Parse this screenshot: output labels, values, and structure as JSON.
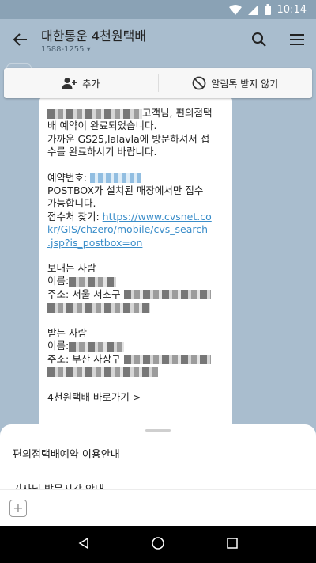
{
  "status_bar": {
    "time": "10:14",
    "icons": [
      "wifi-icon",
      "signal-icon",
      "battery-icon"
    ]
  },
  "header": {
    "title": "대한통운 4천원택배",
    "subtitle": "1588-1255 ▾"
  },
  "action_bar": {
    "add_label": "추가",
    "block_label": "알림톡 받지 않기"
  },
  "message": {
    "p1_line1": "고객님, 편의점택",
    "p1_line2": "배 예약이 완료되었습니다.",
    "p1_line3": "가까운 GS25,lalavla에 방문하셔서 접",
    "p1_line4": "수를 완료하시기 바랍니다.",
    "reservation_label": "예약번호:",
    "postbox_line1": "POSTBOX가 설치된 매장에서만 접수",
    "postbox_line2": "가능합니다.",
    "find_label": "접수처 찾기:",
    "url_line1": "https://www.cvsnet.co",
    "url_line2": "kr/GIS/chzero/mobile/cvs_search",
    "url_line3": ".jsp?is_postbox=on",
    "sender_title": "보내는 사람",
    "sender_name_label": "이름:",
    "sender_addr_label": "주소:",
    "sender_addr": "서울 서초구",
    "receiver_title": "받는 사람",
    "receiver_name_label": "이름:",
    "receiver_addr_label": "주소:",
    "receiver_addr": "부산 사상구",
    "link_label": "4천원택배 바로가기 >"
  },
  "menu": {
    "item1": "편의점택배예약 이용안내",
    "item2": "기사님 방문시간 안내"
  },
  "colors": {
    "chat_background": "#a9bdce",
    "link": "#3a8dc9",
    "navigation_bar": "#000000"
  }
}
